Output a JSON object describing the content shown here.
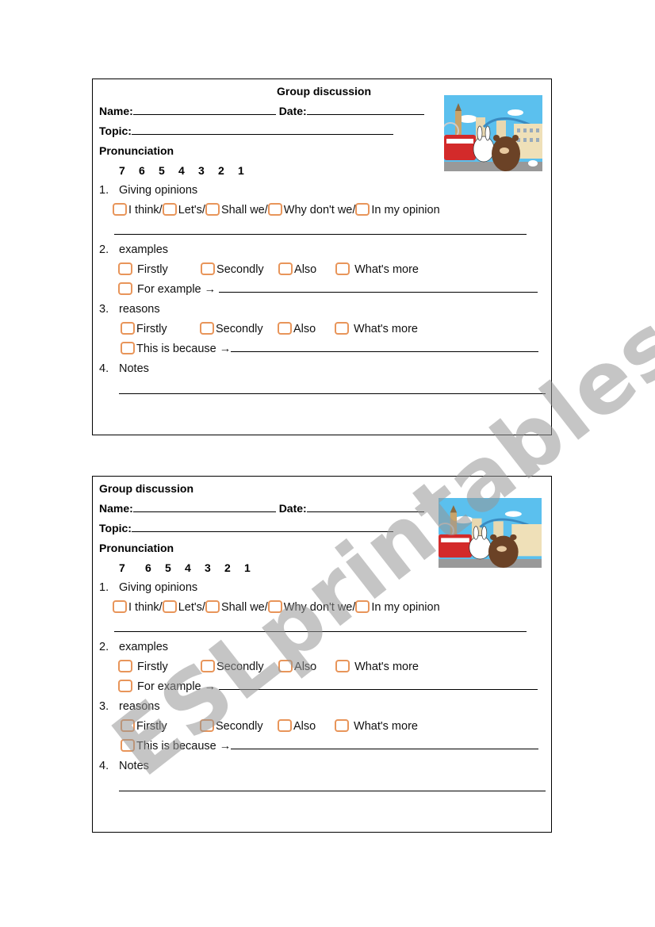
{
  "worksheets": [
    {
      "title": "Group discussion",
      "name_label": "Name:",
      "date_label": "Date:",
      "topic_label": "Topic:",
      "pronunciation_label": "Pronunciation",
      "pronunciation_scores": [
        "7",
        "6",
        "5",
        "4",
        "3",
        "2",
        "1"
      ],
      "sections": [
        {
          "number": "1.",
          "title": "Giving opinions",
          "options": [
            "I think/",
            "Let's/",
            "Shall we/",
            "Why don't we/",
            "In my opinion"
          ]
        },
        {
          "number": "2.",
          "title": "examples",
          "options": [
            "Firstly",
            "Secondly",
            "Also",
            "What's more"
          ],
          "followup": "For example →"
        },
        {
          "number": "3.",
          "title": "reasons",
          "options": [
            "Firstly",
            "Secondly",
            "Also",
            "What's more"
          ],
          "followup": "This is because →"
        },
        {
          "number": "4.",
          "title": "Notes"
        }
      ],
      "image_alt": "cartoon-bear-and-rabbit-london"
    },
    {
      "title": "Group discussion",
      "name_label": "Name:",
      "date_label": "Date:",
      "topic_label": "Topic:",
      "pronunciation_label": "Pronunciation",
      "pronunciation_scores": [
        "7",
        "6",
        "5",
        "4",
        "3",
        "2",
        "1"
      ],
      "sections": [
        {
          "number": "1.",
          "title": "Giving opinions",
          "options": [
            "I think/",
            "Let's/",
            "Shall we/",
            "Why don't we/",
            "In my opinion"
          ]
        },
        {
          "number": "2.",
          "title": "examples",
          "options": [
            "Firstly",
            "Secondly",
            "Also",
            "What's more"
          ],
          "followup": "For example →"
        },
        {
          "number": "3.",
          "title": "reasons",
          "options": [
            "Firstly",
            "Secondly",
            "Also",
            "What's more"
          ],
          "followup": "This is because →"
        },
        {
          "number": "4.",
          "title": "Notes"
        }
      ],
      "image_alt": "cartoon-bear-and-rabbit-london"
    }
  ],
  "watermark": "ESLprintables.com",
  "colors": {
    "checkbox_border": "#e8955a"
  }
}
